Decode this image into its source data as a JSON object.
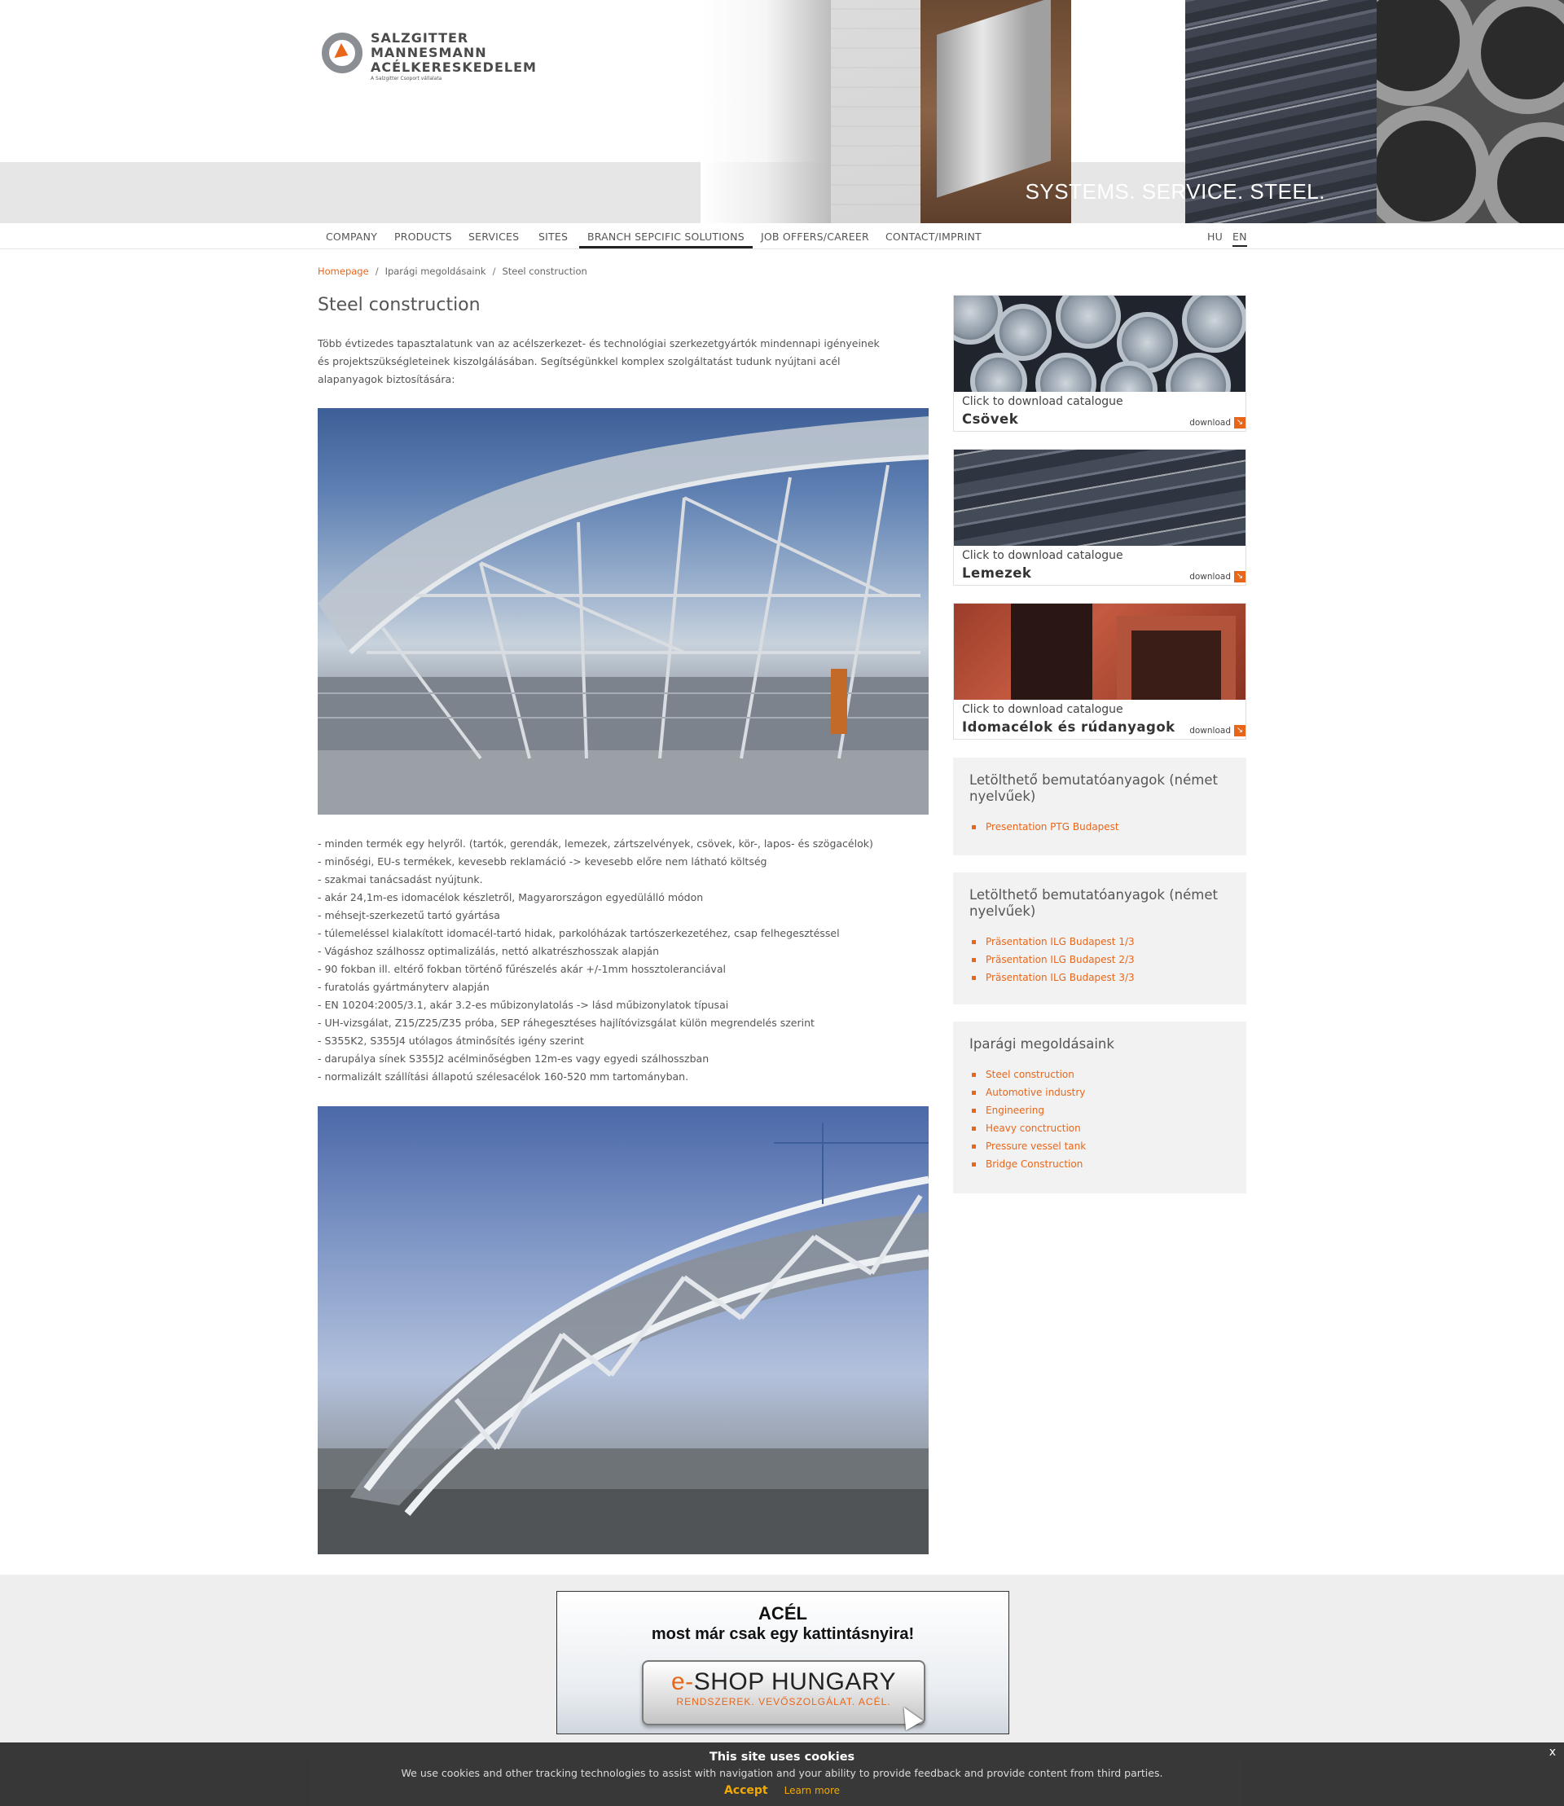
{
  "logo": {
    "line1": "SALZGITTER",
    "line2": "MANNESMANN",
    "line3": "ACÉLKERESKEDELEM",
    "subline": "A Salzgitter Csoport vállalata"
  },
  "header": {
    "tagline": "SYSTEMS. SERVICE. STEEL."
  },
  "nav": {
    "items": [
      {
        "label": "COMPANY"
      },
      {
        "label": "PRODUCTS"
      },
      {
        "label": "SERVICES"
      },
      {
        "label": "SITES"
      },
      {
        "label": "BRANCH SEPCIFIC SOLUTIONS"
      },
      {
        "label": "JOB OFFERS/CAREER"
      },
      {
        "label": "CONTACT/IMPRINT"
      }
    ],
    "lang": [
      "HU",
      "EN"
    ]
  },
  "breadcrumb": {
    "home": "Homepage",
    "parent": "Iparági megoldásaink",
    "current": "Steel construction"
  },
  "main": {
    "title": "Steel construction",
    "intro": "Több évtizedes tapasztalatunk van az acélszerkezet- és technológiai szerkezetgyártók mindennapi igényeinek és projektszükségleteinek kiszolgálásában. Segítségünkkel komplex szolgáltatást tudunk nyújtani acél alapanyagok biztosítására:",
    "features": [
      "- minden termék egy helyről. (tartók, gerendák, lemezek, zártszelvények, csövek, kör-, lapos- és szögacélok)",
      "- minőségi, EU-s termékek, kevesebb reklamáció -> kevesebb előre nem látható költség",
      "- szakmai tanácsadást nyújtunk.",
      "- akár 24,1m-es idomacélok készletről, Magyarországon egyedülálló módon",
      "- méhsejt-szerkezetű tartó gyártása",
      "- túlemeléssel kialakított idomacél-tartó hidak, parkolóházak tartószerkezetéhez, csap felhegesztéssel",
      "- Vágáshoz szálhossz optimalizálás, nettó alkatrészhosszak alapján",
      "- 90 fokban ill. eltérő fokban történő fűrészelés akár +/-1mm hossztoleranciával",
      "- furatolás gyártmányterv alapján",
      "- EN 10204:2005/3.1, akár 3.2-es műbizonylatolás -> lásd műbizonylatok típusai",
      "- UH-vizsgálat, Z15/Z25/Z35 próba, SEP ráhegesztéses hajlítóvizsgálat külön megrendelés szerint",
      "- S355K2, S355J4 utólagos átminősítés igény szerint",
      "- darupálya sínek S355J2 acélminőségben 12m-es vagy egyedi szálhosszban",
      "- normalizált szállítási állapotú szélesacélok 160-520 mm tartományban."
    ]
  },
  "sidebar": {
    "catalogues": [
      {
        "cta": "Click to download catalogue",
        "title": "Csövek",
        "download": "download"
      },
      {
        "cta": "Click to download catalogue",
        "title": "Lemezek",
        "download": "download"
      },
      {
        "cta": "Click to download catalogue",
        "title": "Idomacélok és rúdanyagok",
        "download": "download"
      }
    ],
    "box1": {
      "title": "Letölthető bemutatóanyagok (német nyelvűek)",
      "links": [
        "Presentation PTG Budapest"
      ]
    },
    "box2": {
      "title": "Letölthető bemutatóanyagok (német nyelvűek)",
      "links": [
        "Präsentation ILG Budapest 1/3",
        "Präsentation ILG Budapest 2/3",
        "Präsentation ILG Budapest 3/3"
      ]
    },
    "box3": {
      "title": "Iparági megoldásaink",
      "links": [
        "Steel construction",
        "Automotive industry",
        "Engineering",
        "Heavy conctruction",
        "Pressure vessel tank",
        "Bridge Construction"
      ]
    }
  },
  "eshop": {
    "line1": "ACÉL",
    "line2": "most már csak egy kattintásnyira!",
    "button_e": "e-",
    "button_main": "SHOP HUNGARY",
    "button_sub": "RENDSZEREK. VEVŐSZOLGÁLAT. ACÉL."
  },
  "cookie": {
    "title": "This site uses cookies",
    "text": "We use cookies and other tracking technologies to assist with navigation and your ability to provide feedback and provide content from third parties.",
    "accept": "Accept",
    "learn": "Learn more",
    "close": "x"
  },
  "colors": {
    "accent": "#e8661a",
    "text": "#555555",
    "sidebar_box": "#f2f2f2",
    "cookie_bg": "#303030"
  }
}
